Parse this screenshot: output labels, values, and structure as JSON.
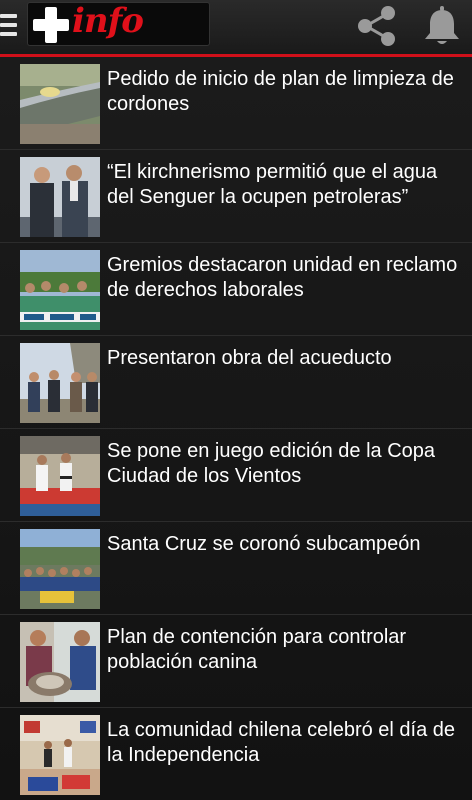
{
  "app": {
    "logo_text": "info",
    "accent_color": "#d0101a",
    "icons": [
      "menu-icon",
      "share-icon",
      "bell-icon"
    ]
  },
  "news": [
    {
      "title": "Pedido de inicio de plan de limpieza de cordones"
    },
    {
      "title": "“El kirchnerismo permitió que el agua del Senguer la ocupen petroleras”"
    },
    {
      "title": "Gremios destacaron unidad en reclamo de derechos laborales"
    },
    {
      "title": "Presentaron obra del acueducto"
    },
    {
      "title": "Se pone en juego edición de la Copa Ciudad de los Vientos"
    },
    {
      "title": "Santa Cruz se coronó subcampeón"
    },
    {
      "title": "Plan de contención para controlar población canina"
    },
    {
      "title": "La comunidad chilena celebró el día de la Independencia"
    }
  ]
}
